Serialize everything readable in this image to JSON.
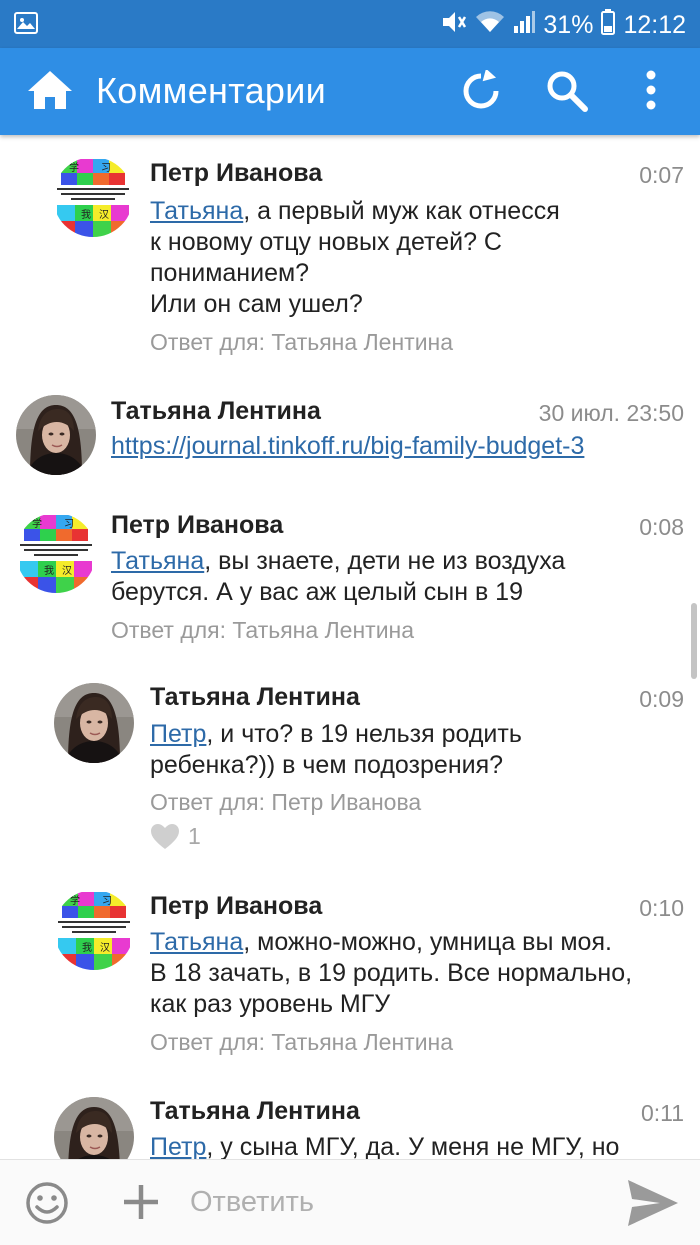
{
  "status_bar": {
    "battery": "31%",
    "time": "12:12",
    "icons": [
      "gallery-icon",
      "mute-icon",
      "wifi-icon",
      "signal-icon",
      "battery-icon"
    ]
  },
  "app_bar": {
    "title": "Комментарии",
    "icons": [
      "home-icon",
      "refresh-icon",
      "search-icon",
      "more-icon"
    ]
  },
  "comments": [
    {
      "author": "Петр Иванова",
      "time": "0:07",
      "mention": "Татьяна",
      "lines": [
        ", а первый муж как отнесся",
        "к новому отцу новых детей? С",
        "пониманием?",
        "Или он сам ушел?"
      ],
      "reply_to": "Ответ для: Татьяна Лентина"
    },
    {
      "author": "Татьяна Лентина",
      "time": "30 июл. 23:50",
      "link": "https://journal.tinkoff.ru/big-family-budget-3"
    },
    {
      "author": "Петр Иванова",
      "time": "0:08",
      "mention": "Татьяна",
      "lines": [
        ", вы знаете, дети не из воздуха",
        "берутся. А у вас аж целый сын в 19"
      ],
      "reply_to": "Ответ для: Татьяна Лентина"
    },
    {
      "author": "Татьяна Лентина",
      "time": "0:09",
      "mention": "Петр",
      "lines": [
        ", и что? в 19 нельзя родить",
        "ребенка?)) в чем подозрения?"
      ],
      "reply_to": "Ответ для: Петр Иванова",
      "likes": "1"
    },
    {
      "author": "Петр Иванова",
      "time": "0:10",
      "mention": "Татьяна",
      "lines": [
        ", можно-можно, умница вы моя.",
        "В 18 зачать, в 19 родить. Все нормально,",
        "как раз уровень МГУ"
      ],
      "reply_to": "Ответ для: Татьяна Лентина"
    },
    {
      "author": "Татьяна Лентина",
      "time": "0:11",
      "mention": "Петр",
      "lines": [
        ", у сына МГУ, да. У меня не МГУ, но"
      ]
    }
  ],
  "composer": {
    "placeholder": "Ответить",
    "icons": [
      "emoji-icon",
      "plus-icon",
      "send-icon"
    ]
  },
  "colors": {
    "status_bar": "#2a7ac6",
    "app_bar": "#2f8ee5",
    "mention": "#2d6aa8",
    "secondary_text": "#8c8c8c"
  }
}
